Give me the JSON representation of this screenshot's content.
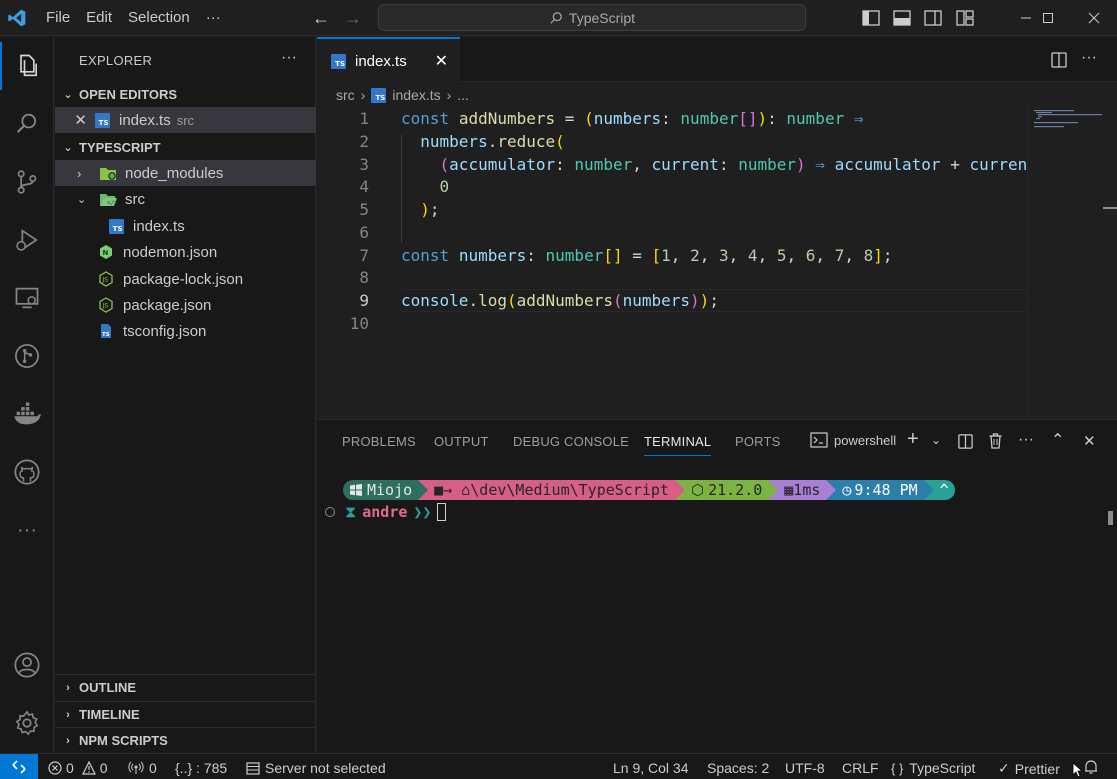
{
  "titlebar": {
    "menu": [
      "File",
      "Edit",
      "Selection",
      "···"
    ],
    "search_text": "TypeScript"
  },
  "sidebar": {
    "title": "EXPLORER",
    "more": "···",
    "open_editors_header": "OPEN EDITORS",
    "open_editor": {
      "name": "index.ts",
      "desc": "src"
    },
    "project_header": "TYPESCRIPT",
    "tree": [
      {
        "name": "node_modules",
        "type": "folder"
      },
      {
        "name": "src",
        "type": "folder-open"
      },
      {
        "name": "index.ts",
        "type": "ts"
      },
      {
        "name": "nodemon.json",
        "type": "nodemon"
      },
      {
        "name": "package-lock.json",
        "type": "json"
      },
      {
        "name": "package.json",
        "type": "json"
      },
      {
        "name": "tsconfig.json",
        "type": "tsconfig"
      }
    ],
    "outline": "OUTLINE",
    "timeline": "TIMELINE",
    "npm_scripts": "NPM SCRIPTS"
  },
  "editor": {
    "tab_label": "index.ts",
    "tab_icon_text": "TS",
    "breadcrumb": [
      "src",
      "index.ts",
      "..."
    ],
    "line_numbers": [
      "1",
      "2",
      "3",
      "4",
      "5",
      "6",
      "7",
      "8",
      "9",
      "10"
    ],
    "current_line": 9
  },
  "panel": {
    "tabs": [
      "PROBLEMS",
      "OUTPUT",
      "DEBUG CONSOLE",
      "TERMINAL",
      "PORTS"
    ],
    "active_tab": "TERMINAL",
    "shell": "powershell",
    "prompt": {
      "user": "Miojo",
      "path": "→ ⌂\\dev\\Medium\\TypeScript",
      "node": "21.2.0",
      "duration": "1ms",
      "time": "9:48 PM",
      "git": "^"
    },
    "prompt2": {
      "name": "andre",
      "arrows": "❯❯"
    }
  },
  "statusbar": {
    "errors": "0",
    "warnings": "0",
    "ports": "0",
    "json_count": "{..} : 785",
    "server": "Server not selected",
    "position": "Ln 9, Col 34",
    "spaces": "Spaces: 2",
    "encoding": "UTF-8",
    "eol": "CRLF",
    "language": "TypeScript",
    "prettier": "Prettier"
  },
  "colors": {
    "accent": "#0078d4",
    "ts_blue": "#3178c6"
  }
}
